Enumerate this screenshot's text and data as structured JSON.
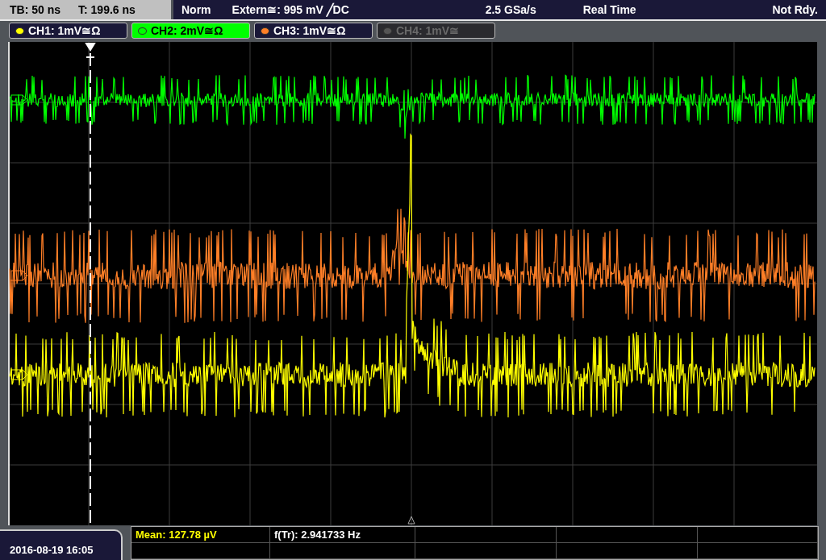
{
  "status_bar": {
    "timebase": "TB: 50 ns",
    "trigger_time": "T: 199.6 ns",
    "mode": "Norm",
    "trigger": "Extern≅: 995 mV ╱DC",
    "sample_rate": "2.5 GSa/s",
    "acquisition": "Real Time",
    "state": "Not Rdy."
  },
  "channels": [
    {
      "label": "CH1: 1mV≅Ω",
      "color": "#ffff00",
      "selected": false,
      "disabled": false
    },
    {
      "label": "CH2: 2mV≅Ω",
      "color": "#00ff00",
      "selected": true,
      "disabled": false
    },
    {
      "label": "CH3: 1mV≅Ω",
      "color": "#ff7f27",
      "selected": false,
      "disabled": false
    },
    {
      "label": "CH4: 1mV≅",
      "color": "#555555",
      "selected": false,
      "disabled": true
    }
  ],
  "timestamp": "2016-08-19 16:05",
  "measurements": [
    {
      "text": "Mean: 127.78 µV",
      "color": "#ffff00"
    },
    {
      "text": "f(Tr): 2.941733 Hz",
      "color": "#ffffff"
    }
  ]
}
